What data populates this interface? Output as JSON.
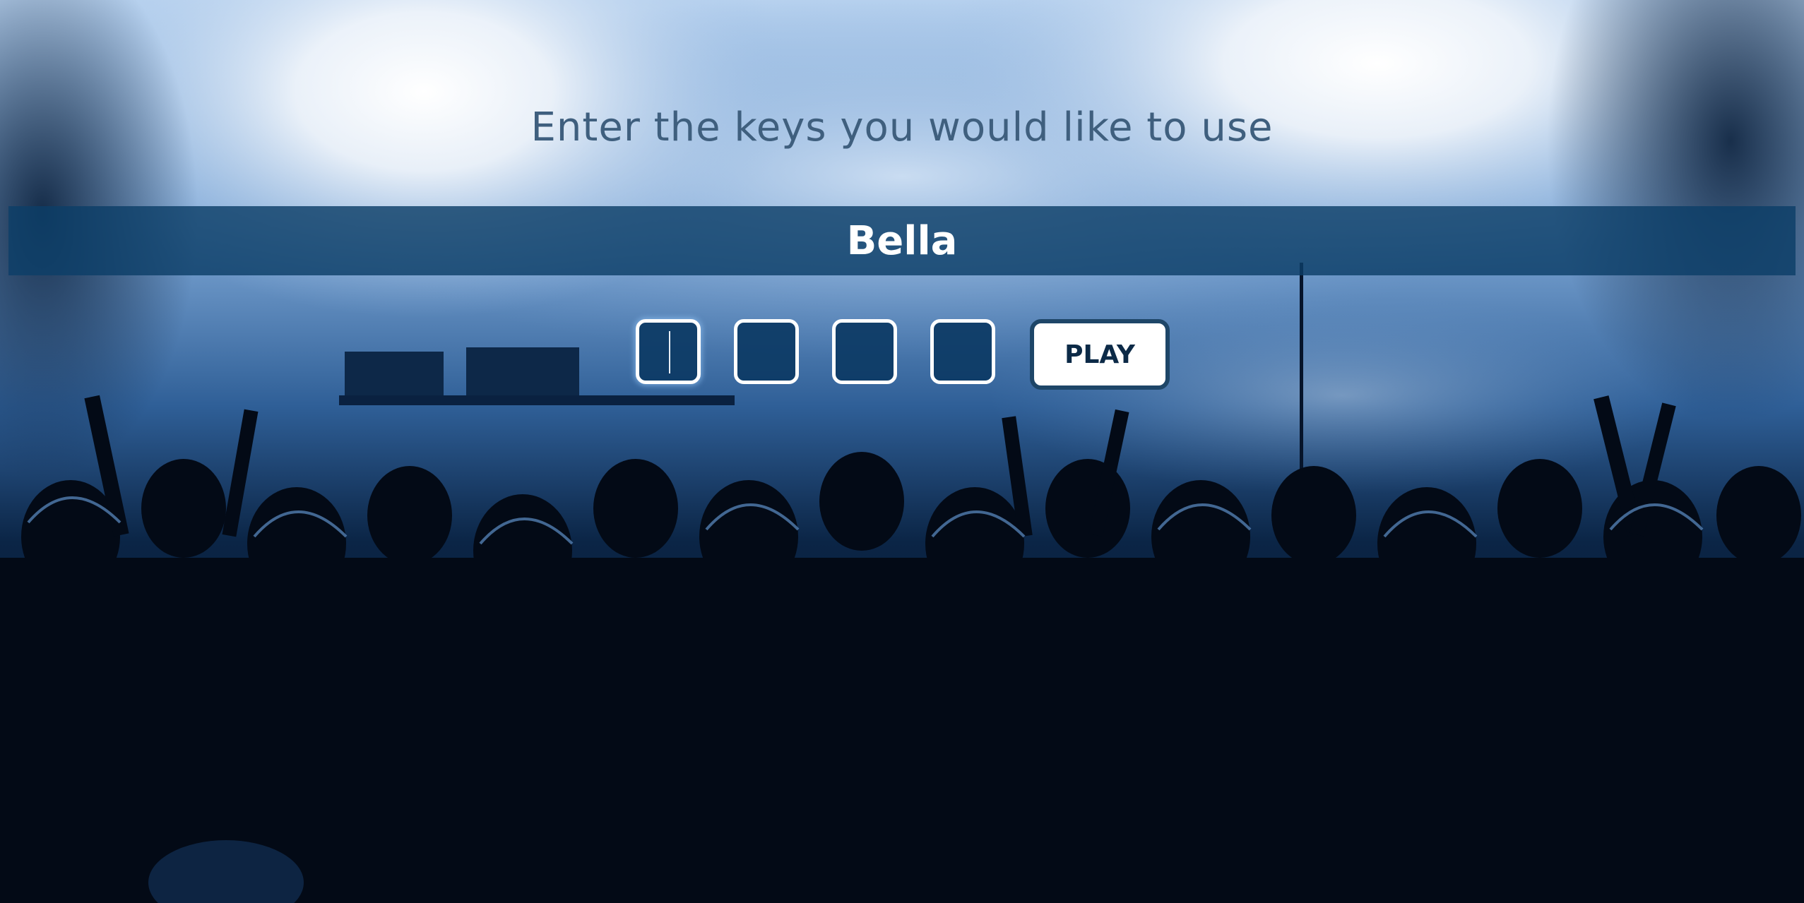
{
  "prompt": "Enter the keys you would like to use",
  "player_name": "Bella",
  "keys": [
    "",
    "",
    "",
    ""
  ],
  "play_label": "PLAY",
  "colors": {
    "name_bar": "#0c3e68",
    "key_fill": "#0c3a64",
    "play_border": "#1e4668",
    "prompt_text": "#3f5f7e"
  }
}
